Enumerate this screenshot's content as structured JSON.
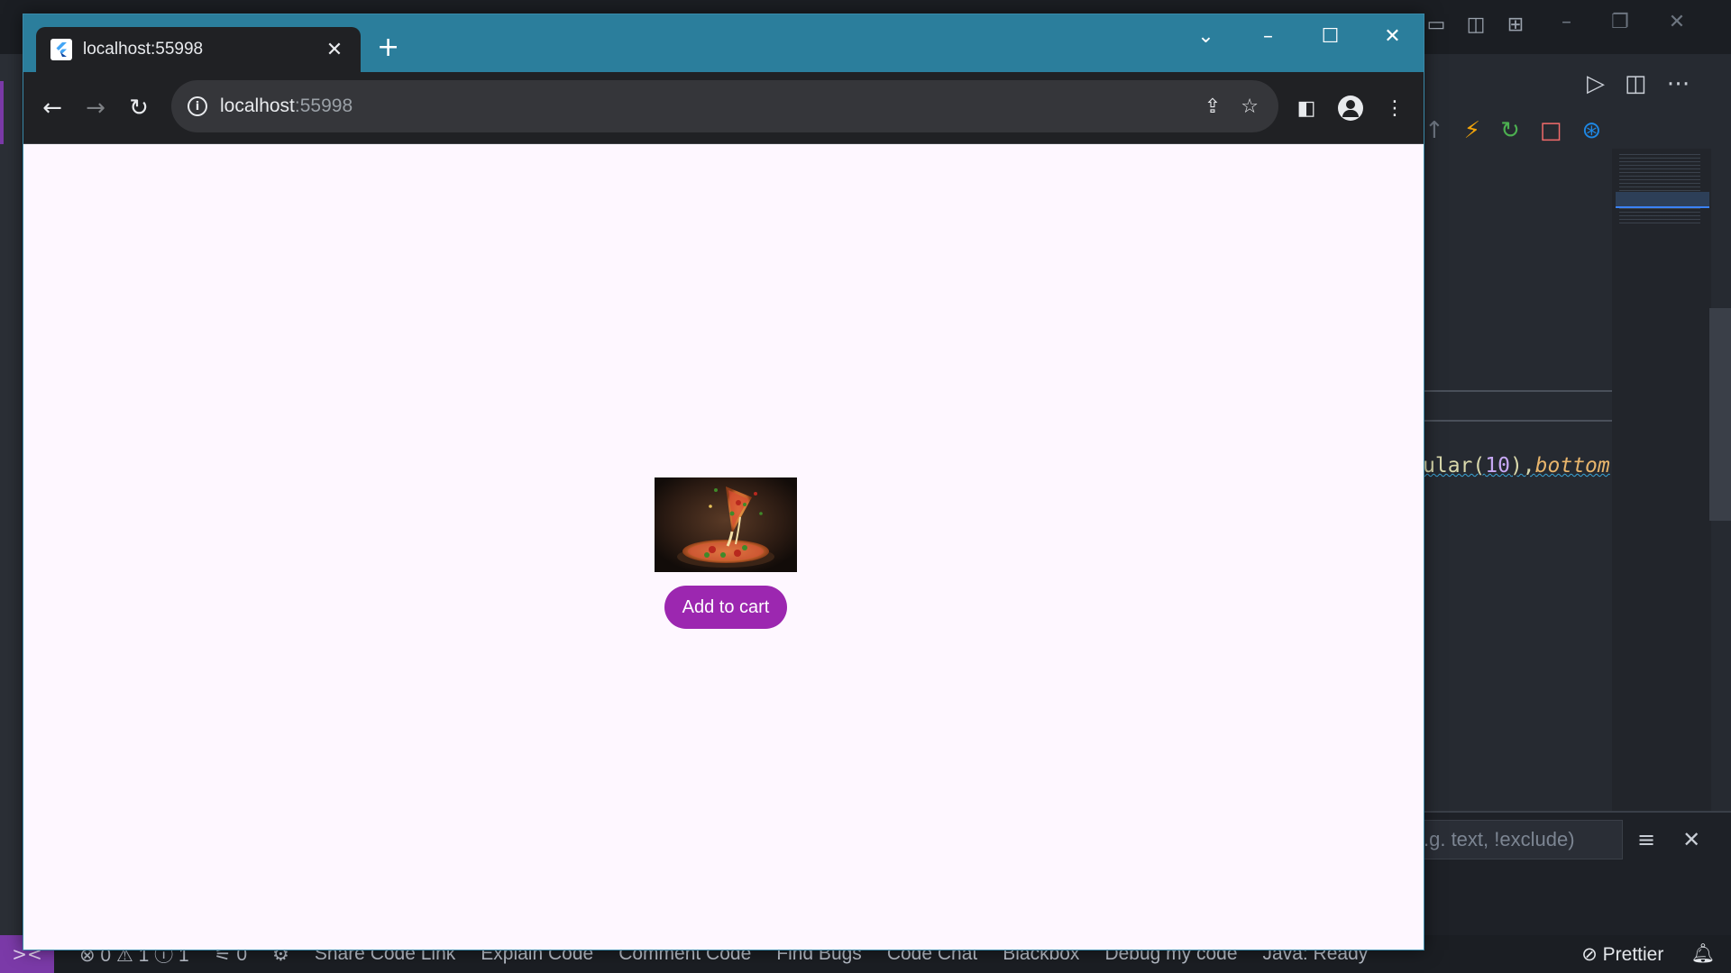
{
  "background_ide": {
    "code_fragment": {
      "prefix": "ular(",
      "number": "10",
      "middle": "),",
      "italic": "bottom"
    },
    "filter_placeholder": ".g. text, !exclude)",
    "statusbar": {
      "remote_icon": "remote-icon",
      "problems": "⊗ 0 ⚠ 1 ⓘ 1",
      "ports": "0",
      "items": [
        "Share Code Link",
        "Explain Code",
        "Comment Code",
        "Find Bugs",
        "Code Chat",
        "Blackbox",
        "Debug my code",
        "Java: Ready"
      ],
      "prettier": "Prettier"
    },
    "colors": {
      "accent": "#7b3aa8",
      "hot_reload": "#f0a30a",
      "restart": "#4caf50",
      "stop": "#f26b6b",
      "devtools": "#1e88e5"
    }
  },
  "browser": {
    "tab": {
      "title": "localhost:55998",
      "favicon": "flutter-icon"
    },
    "address": {
      "host": "localhost",
      "port": ":55998"
    },
    "theme_color": "#2b7e9c"
  },
  "page": {
    "product_image_alt": "pizza-image",
    "add_to_cart_label": "Add to cart",
    "button_color": "#9c27b0"
  }
}
